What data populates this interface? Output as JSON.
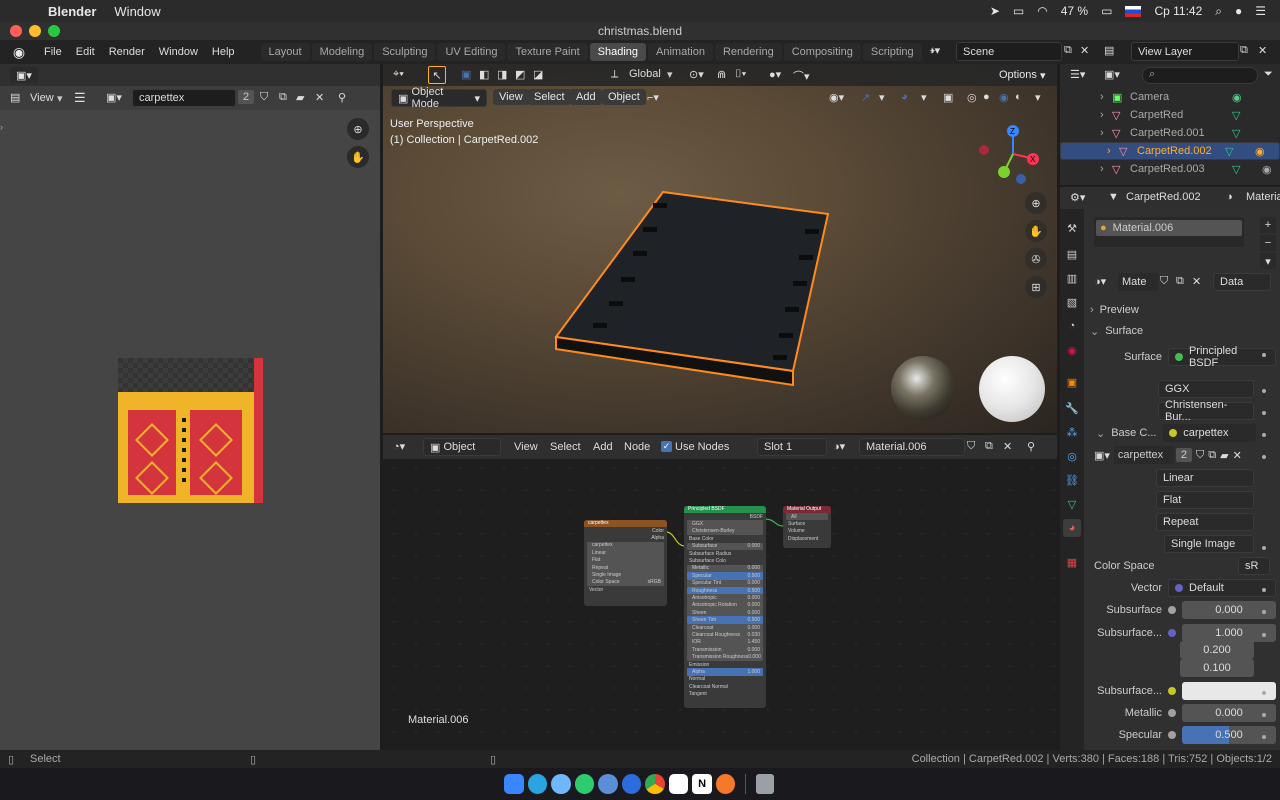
{
  "macbar": {
    "apple": "",
    "app_name": "Blender",
    "menu": "Window",
    "battery": "47 %",
    "clock": "Ср 11:42"
  },
  "window": {
    "title": "christmas.blend"
  },
  "topbar": {
    "menus": [
      "File",
      "Edit",
      "Render",
      "Window",
      "Help"
    ],
    "workspaces": [
      "Layout",
      "Modeling",
      "Sculpting",
      "UV Editing",
      "Texture Paint",
      "Shading",
      "Animation",
      "Rendering",
      "Compositing",
      "Scripting"
    ],
    "active_workspace": "Shading",
    "scene": "Scene",
    "view_layer": "View Layer"
  },
  "image_editor": {
    "view_menu": "View",
    "image_name": "carpettex",
    "users": "2"
  },
  "viewport": {
    "transform": "Global",
    "options": "Options",
    "mode": "Object Mode",
    "menus": [
      "View",
      "Select",
      "Add",
      "Object"
    ],
    "overlay_line1": "User Perspective",
    "overlay_line2": "(1) Collection | CarpetRed.002"
  },
  "node_editor": {
    "type": "Object",
    "menus": [
      "View",
      "Select",
      "Add",
      "Node"
    ],
    "use_nodes": "Use Nodes",
    "slot": "Slot 1",
    "material": "Material.006",
    "corner_label": "Material.006",
    "image_node": {
      "title": "carpettex",
      "outputs": [
        "Color",
        "Alpha"
      ],
      "image": "carpettex",
      "rows": [
        "Linear",
        "Flat",
        "Repeat",
        "Single Image"
      ],
      "color_space_label": "Color Space",
      "color_space": "sRGB",
      "vector": "Vector"
    },
    "bsdf_node": {
      "title": "Principled BSDF",
      "output": "BSDF",
      "rows": [
        [
          "GGX",
          ""
        ],
        [
          "Christensen-Burley",
          ""
        ],
        [
          "Base Color",
          ""
        ],
        [
          "Subsurface",
          "0.000"
        ],
        [
          "Subsurface Radius",
          ""
        ],
        [
          "Subsurface Colo",
          ""
        ],
        [
          "Metallic",
          "0.000"
        ],
        [
          "Specular",
          "0.500"
        ],
        [
          "Specular Tint",
          "0.000"
        ],
        [
          "Roughness",
          "0.500"
        ],
        [
          "Anisotropic",
          "0.000"
        ],
        [
          "Anisotropic Rotation",
          "0.000"
        ],
        [
          "Sheen",
          "0.000"
        ],
        [
          "Sheen Tint",
          "0.500"
        ],
        [
          "Clearcoat",
          "0.000"
        ],
        [
          "Clearcoat Roughness",
          "0.030"
        ],
        [
          "IOR",
          "1.450"
        ],
        [
          "Transmission",
          "0.000"
        ],
        [
          "Transmission Roughness",
          "0.000"
        ],
        [
          "Emission",
          ""
        ],
        [
          "Alpha",
          "1.000"
        ],
        [
          "Normal",
          ""
        ],
        [
          "Clearcoat Normal",
          ""
        ],
        [
          "Tangent",
          ""
        ]
      ]
    },
    "output_node": {
      "title": "Material Output",
      "target": "All",
      "inputs": [
        "Surface",
        "Volume",
        "Displacement"
      ]
    }
  },
  "outliner": {
    "items": [
      {
        "name": "Camera",
        "selected": false
      },
      {
        "name": "CarpetRed",
        "selected": false
      },
      {
        "name": "CarpetRed.001",
        "selected": false
      },
      {
        "name": "CarpetRed.002",
        "selected": true
      },
      {
        "name": "CarpetRed.003",
        "selected": false
      }
    ]
  },
  "properties": {
    "object_name": "CarpetRed.002",
    "material_tab": "Materia",
    "slot_material": "Material.006",
    "material_field": "Mate",
    "data_dd": "Data",
    "preview": "Preview",
    "surface_panel": "Surface",
    "surface_label": "Surface",
    "surface_value": "Principled BSDF",
    "distribution": "GGX",
    "subsurface_method": "Christensen-Bur...",
    "base_color_label": "Base C...",
    "base_color_value": "carpettex",
    "image_name": "carpettex",
    "image_users": "2",
    "interpolation": "Linear",
    "projection": "Flat",
    "extension": "Repeat",
    "source": "Single Image",
    "color_space_label": "Color Space",
    "color_space": "sR",
    "vector_label": "Vector",
    "vector_value": "Default",
    "subsurface_label": "Subsurface",
    "subsurface_value": "0.000",
    "subsurface_radius_label": "Subsurface...",
    "subsurface_radius": [
      "1.000",
      "0.200",
      "0.100"
    ],
    "subsurface_color_label": "Subsurface...",
    "metallic_label": "Metallic",
    "metallic_value": "0.000",
    "specular_label": "Specular",
    "specular_value": "0.500",
    "specular_fraction": 0.5
  },
  "statusbar": {
    "left": "Select",
    "right": "Collection | CarpetRed.002 | Verts:380 | Faces:188 | Tris:752 | Objects:1/2"
  },
  "colors": {
    "accent_blue": "#4772b3",
    "selected_orange": "#ffaf29",
    "outliner_selected": "#334d80"
  }
}
